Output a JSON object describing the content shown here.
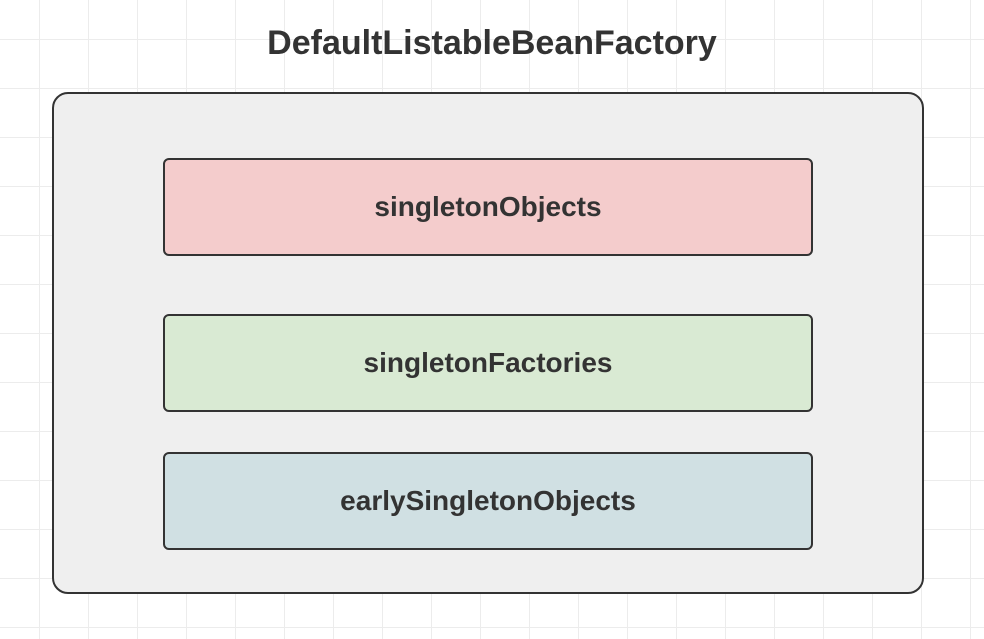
{
  "diagram": {
    "title": "DefaultListableBeanFactory",
    "container": {
      "boxes": [
        {
          "label": "singletonObjects",
          "colorHex": "#f4cccc"
        },
        {
          "label": "singletonFactories",
          "colorHex": "#d9ead3"
        },
        {
          "label": "earlySingletonObjects",
          "colorHex": "#d0e0e3"
        }
      ]
    }
  }
}
